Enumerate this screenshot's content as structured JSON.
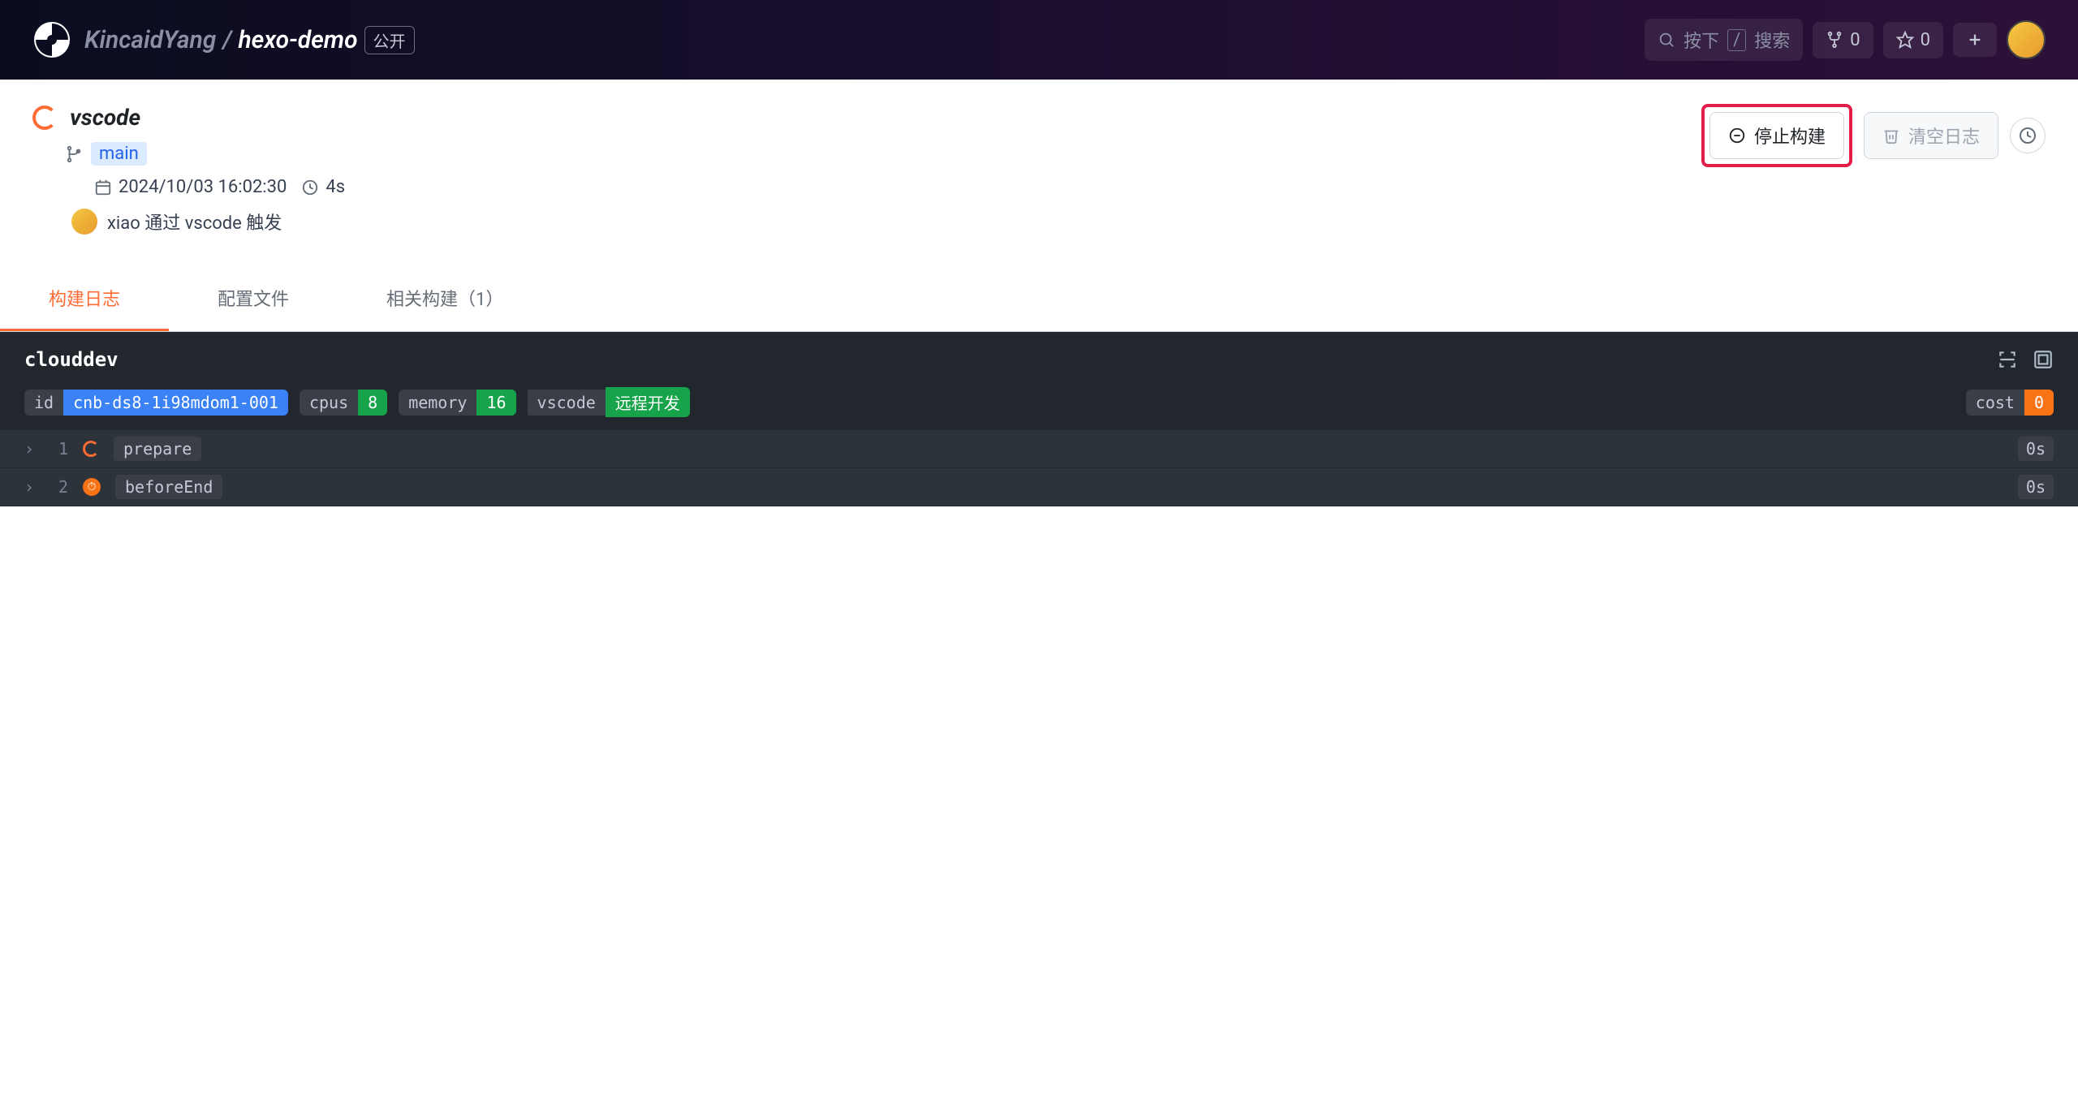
{
  "header": {
    "owner": "KincaidYang",
    "separator": "/",
    "repo": "hexo-demo",
    "visibility": "公开",
    "search_hint_left": "按下",
    "search_hint_right": "搜索",
    "fork_count": "0",
    "star_count": "0"
  },
  "build": {
    "title": "vscode",
    "branch": "main",
    "timestamp": "2024/10/03 16:02:30",
    "duration": "4s",
    "trigger_text": "xiao 通过 vscode 触发",
    "stop_label": "停止构建",
    "clear_label": "清空日志"
  },
  "tabs": {
    "log": "构建日志",
    "config": "配置文件",
    "related": "相关构建（1）"
  },
  "log": {
    "title": "clouddev",
    "badges": {
      "id_key": "id",
      "id_val": "cnb-ds8-1i98mdom1-001",
      "cpus_key": "cpus",
      "cpus_val": "8",
      "memory_key": "memory",
      "memory_val": "16",
      "vscode_key": "vscode",
      "vscode_val": "远程开发",
      "cost_key": "cost",
      "cost_val": "0"
    },
    "rows": [
      {
        "num": "1",
        "name": "prepare",
        "time": "0s",
        "status": "running"
      },
      {
        "num": "2",
        "name": "beforeEnd",
        "time": "0s",
        "status": "pending"
      }
    ]
  }
}
